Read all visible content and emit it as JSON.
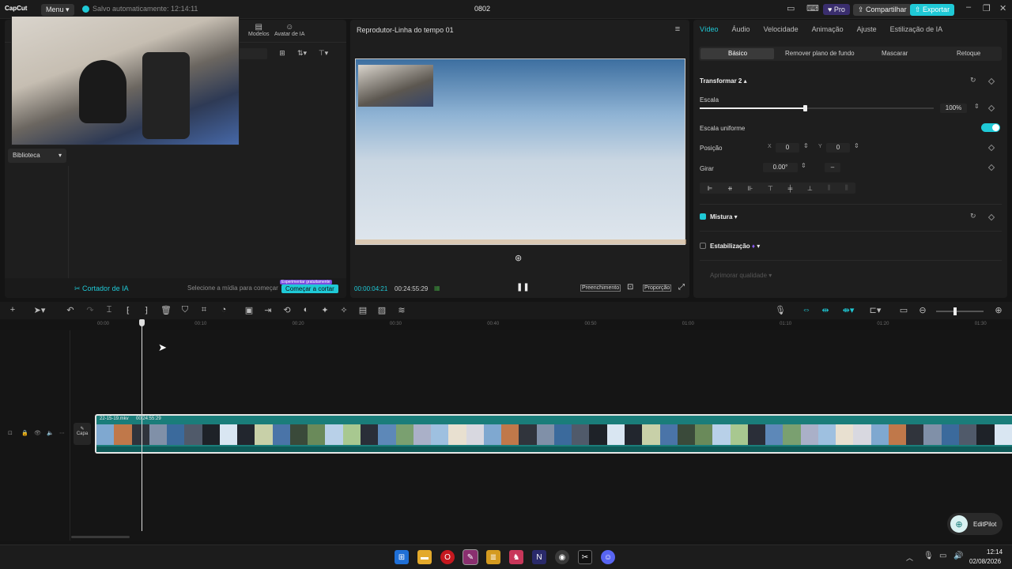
{
  "app": {
    "logo": "CapCut",
    "menu_label": "Menu",
    "autosave": "Salvo automaticamente: 12:14:11",
    "project_name": "0802",
    "pro_label": "Pro",
    "share_label": "Compartilhar",
    "export_label": "Exportar"
  },
  "left": {
    "tabs": [
      "Modelos",
      "Avatar de IA"
    ],
    "library_label": "Biblioteca",
    "ai_cutter_label": "Cortador de IA",
    "select_media_hint": "Selecione a mídia para começar",
    "start_cut_label": "Começar a cortar",
    "trial_badge": "Experimentar gratuitamente"
  },
  "player": {
    "title": "Reprodutor-Linha do tempo 01",
    "current_time": "00:00:04:21",
    "total_time": "00:24:55:29",
    "fill_label": "Preenchimento",
    "ratio_label": "Proporção"
  },
  "inspector": {
    "tabs": [
      "Vídeo",
      "Áudio",
      "Velocidade",
      "Animação",
      "Ajuste",
      "Estilização de IA"
    ],
    "subtabs": [
      "Básico",
      "Remover plano de fundo",
      "Mascarar",
      "Retoque"
    ],
    "transform_label": "Transformar 2",
    "scale_label": "Escala",
    "scale_value": "100%",
    "scale_level": 0.45,
    "uniform_scale_label": "Escala uniforme",
    "position_label": "Posição",
    "pos_x_label": "X",
    "pos_x": "0",
    "pos_y_label": "Y",
    "pos_y": "0",
    "rotate_label": "Girar",
    "rotate_value": "0.00°",
    "rotate_dash": "–",
    "blend_label": "Mistura",
    "stabilization_label": "Estabilização",
    "quality_label": "Aprimorar qualidade"
  },
  "timeline": {
    "ruler": [
      "00:00",
      "00:10",
      "00:20",
      "00:30",
      "00:40",
      "00:50",
      "01:00",
      "01:10",
      "01:20",
      "01:30"
    ],
    "clip_name": "22-15-19.mkv",
    "clip_duration": "00:24:55:29",
    "cover_label": "Capa"
  },
  "editpilot": {
    "label": "EditPilot"
  },
  "taskbar": {
    "time": "12:14",
    "date": "02/08/2026"
  },
  "colors": {
    "accent": "#1fc9d6",
    "clip": "#1a7d7a",
    "pro": "#3a2e6e"
  }
}
